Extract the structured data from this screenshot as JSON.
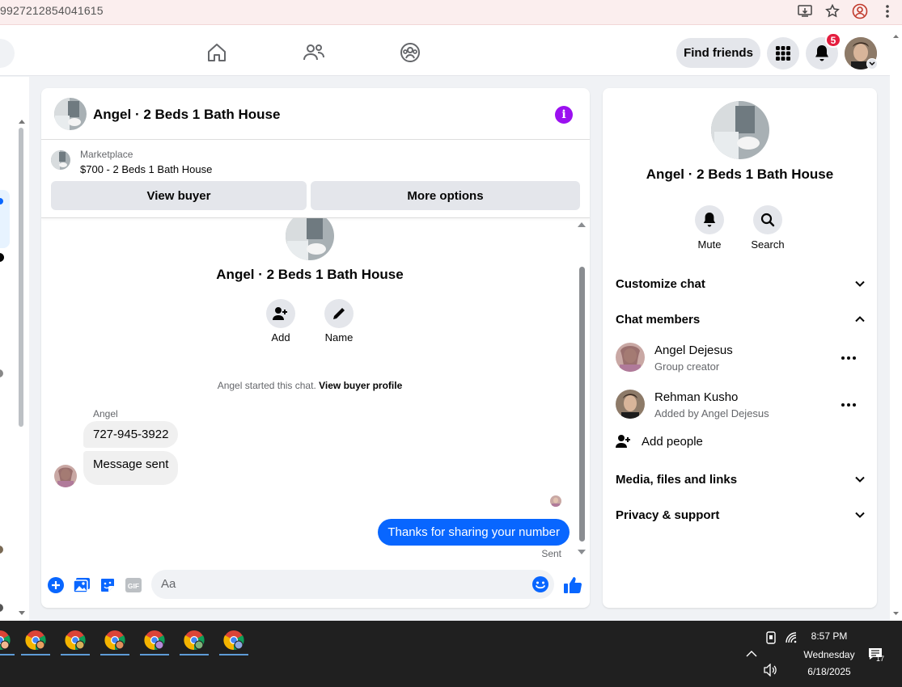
{
  "browser": {
    "url": "99272128540416 15",
    "url_display": "9927212854041615"
  },
  "topnav": {
    "find_friends_label": "Find friends",
    "notification_count": "5"
  },
  "chat": {
    "header_title": "Angel · 2 Beds 1 Bath House",
    "marketplace_label": "Marketplace",
    "listing_price_title": "$700 - 2 Beds 1 Bath House",
    "view_buyer_label": "View buyer",
    "more_options_label": "More options",
    "group_title": "Angel · 2 Beds 1 Bath House",
    "add_label": "Add",
    "name_label": "Name",
    "system_text": "Angel started this chat.",
    "system_link": "View buyer profile",
    "sender_name": "Angel",
    "messages_in": [
      "727-945-3922",
      "Message sent"
    ],
    "message_out": "Thanks for sharing your number",
    "sent_status": "Sent",
    "composer_placeholder": "Aa",
    "gif_label": "GIF"
  },
  "info_panel": {
    "title": "Angel · 2 Beds 1 Bath House",
    "mute_label": "Mute",
    "search_label": "Search",
    "customize_chat": "Customize chat",
    "chat_members": "Chat members",
    "members": [
      {
        "name": "Angel Dejesus",
        "sub": "Group creator"
      },
      {
        "name": "Rehman Kusho",
        "sub": "Added by Angel Dejesus"
      }
    ],
    "add_people": "Add people",
    "media_files_links": "Media, files and links",
    "privacy_support": "Privacy & support"
  },
  "taskbar": {
    "time": "8:57 PM",
    "day": "Wednesday",
    "date": "6/18/2025",
    "notification_count": "17"
  },
  "colors": {
    "accent_blue": "#0866ff",
    "info_purple": "#9b10f0",
    "badge_red": "#e41e3f"
  }
}
